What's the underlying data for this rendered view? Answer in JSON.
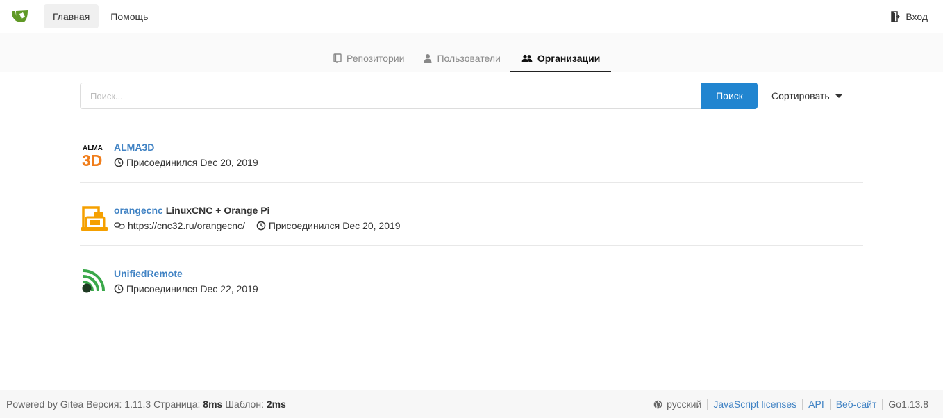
{
  "nav": {
    "home": "Главная",
    "help": "Помощь",
    "signin": "Вход"
  },
  "tabs": [
    {
      "label": "Репозитории",
      "icon": "repo-icon"
    },
    {
      "label": "Пользователи",
      "icon": "person-icon"
    },
    {
      "label": "Организации",
      "icon": "organization-icon",
      "active": true
    }
  ],
  "search": {
    "placeholder": "Поиск...",
    "button": "Поиск",
    "sort_label": "Сортировать"
  },
  "orgs": [
    {
      "name": "ALMA3D",
      "full_name": "",
      "website": "",
      "joined_label": "Присоединился",
      "joined_date": "Dec 20, 2019",
      "avatar": "alma3d-logo"
    },
    {
      "name": "orangecnc",
      "full_name": "LinuxCNC + Orange Pi",
      "website": "https://cnc32.ru/orangecnc/",
      "joined_label": "Присоединился",
      "joined_date": "Dec 20, 2019",
      "avatar": "orangecnc-logo"
    },
    {
      "name": "UnifiedRemote",
      "full_name": "",
      "website": "",
      "joined_label": "Присоединился",
      "joined_date": "Dec 22, 2019",
      "avatar": "unifiedremote-logo"
    }
  ],
  "footer": {
    "powered": "Powered by Gitea",
    "version_label": "Версия:",
    "version": "1.11.3",
    "page_label": "Страница:",
    "page_time": "8ms",
    "template_label": "Шаблон:",
    "template_time": "2ms",
    "language": "русский",
    "js_licenses": "JavaScript licenses",
    "api": "API",
    "website": "Веб-сайт",
    "go_version": "Go1.13.8"
  },
  "colors": {
    "primary": "#2185d0",
    "link": "#4183c4",
    "logo_green": "#609926"
  }
}
